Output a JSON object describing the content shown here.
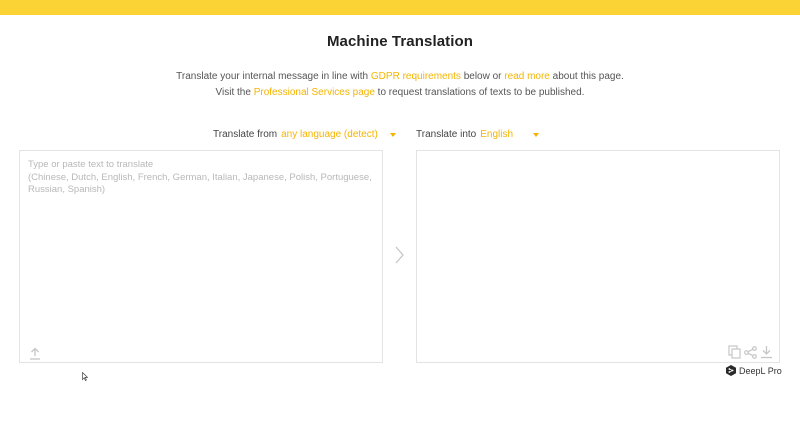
{
  "colors": {
    "top_bar": "#fbd334",
    "accent": "#f5b400",
    "icon": "#c6c6c6",
    "border": "#e3e3e3"
  },
  "header": {
    "title": "Machine Translation"
  },
  "intro": {
    "line1_prefix": "Translate your internal message in line with ",
    "gdpr_link": "GDPR requirements",
    "line1_middle": " below or ",
    "read_more_link": "read more",
    "line1_suffix": " about this page.",
    "line2_prefix": "Visit the ",
    "services_link": "Professional Services page",
    "line2_suffix": " to request translations of texts to be published."
  },
  "source": {
    "label": "Translate from",
    "language": "any language (detect)",
    "value": "",
    "placeholder": "Type or paste text to translate\n(Chinese, Dutch, English, French, German, Italian, Japanese, Polish, Portuguese, Russian, Spanish)"
  },
  "target": {
    "label": "Translate into",
    "language": "English"
  },
  "icons": {
    "upload": "upload-icon",
    "translate": "chevron-right-icon",
    "copy": "copy-icon",
    "share": "share-icon",
    "download": "download-icon"
  },
  "brand": {
    "label": "DeepL Pro"
  }
}
